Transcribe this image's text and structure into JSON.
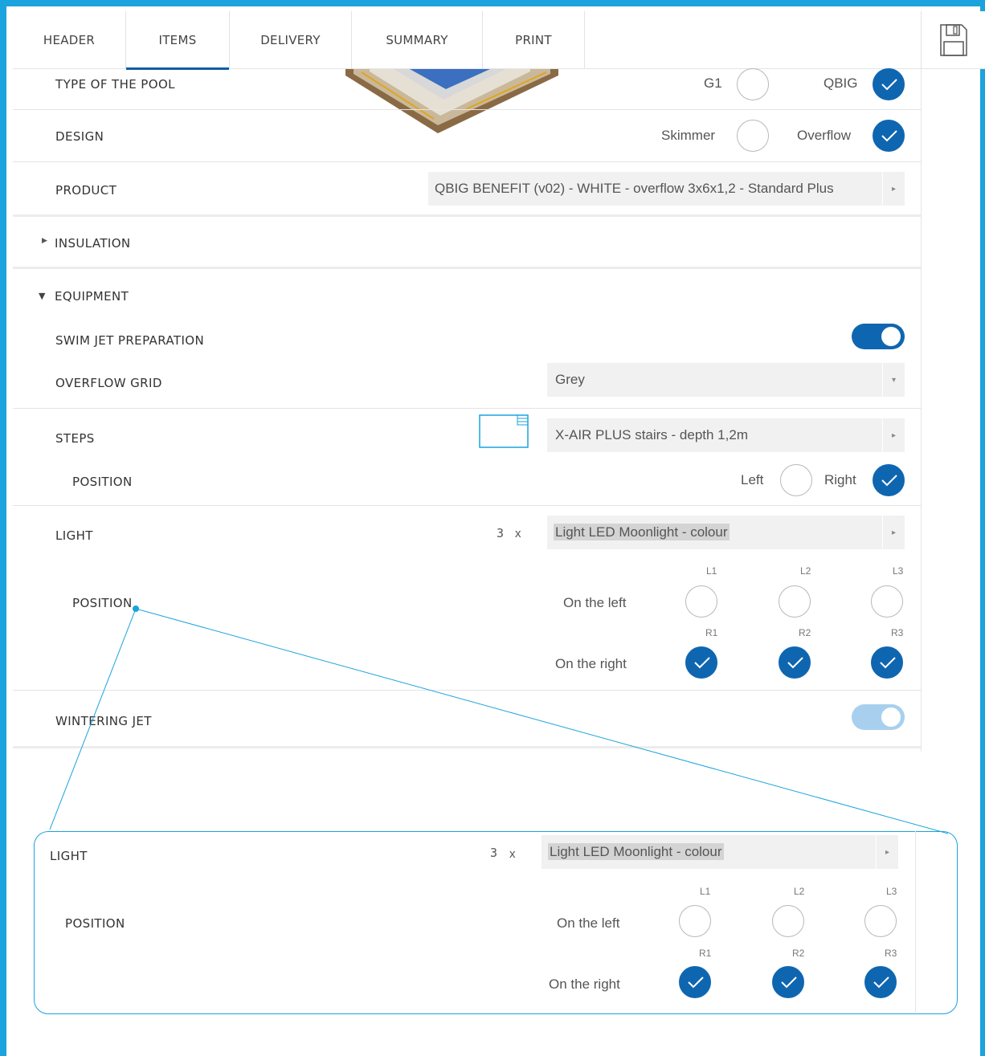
{
  "tabs": [
    {
      "label": "HEADER"
    },
    {
      "label": "ITEMS"
    },
    {
      "label": "DELIVERY"
    },
    {
      "label": "SUMMARY"
    },
    {
      "label": "PRINT"
    }
  ],
  "pool_type": {
    "label": "TYPE OF THE POOL",
    "options": [
      "G1",
      "QBIG"
    ]
  },
  "design": {
    "label": "DESIGN",
    "options": [
      "Skimmer",
      "Overflow"
    ]
  },
  "product": {
    "label": "PRODUCT",
    "value": "QBIG BENEFIT (v02) - WHITE - overflow 3x6x1,2 - Standard Plus"
  },
  "insulation": {
    "label": "INSULATION"
  },
  "equipment": {
    "label": "EQUIPMENT",
    "swim_jet": {
      "label": "SWIM JET PREPARATION"
    },
    "overflow_grid": {
      "label": "OVERFLOW GRID",
      "value": "Grey"
    },
    "steps": {
      "label": "STEPS",
      "value": "X-AIR PLUS stairs - depth 1,2m"
    },
    "steps_position": {
      "label": "POSITION",
      "options": [
        "Left",
        "Right"
      ]
    },
    "light": {
      "label": "LIGHT",
      "qty": "3",
      "times": "x",
      "value": "Light LED Moonlight - colour",
      "position_label": "POSITION",
      "left_label": "On the left",
      "right_label": "On the right",
      "left_slots": [
        "L1",
        "L2",
        "L3"
      ],
      "right_slots": [
        "R1",
        "R2",
        "R3"
      ]
    },
    "wintering_jet": {
      "label": "WINTERING JET"
    }
  },
  "colors": {
    "accent": "#0f66b0",
    "frame": "#1aa3dc"
  }
}
